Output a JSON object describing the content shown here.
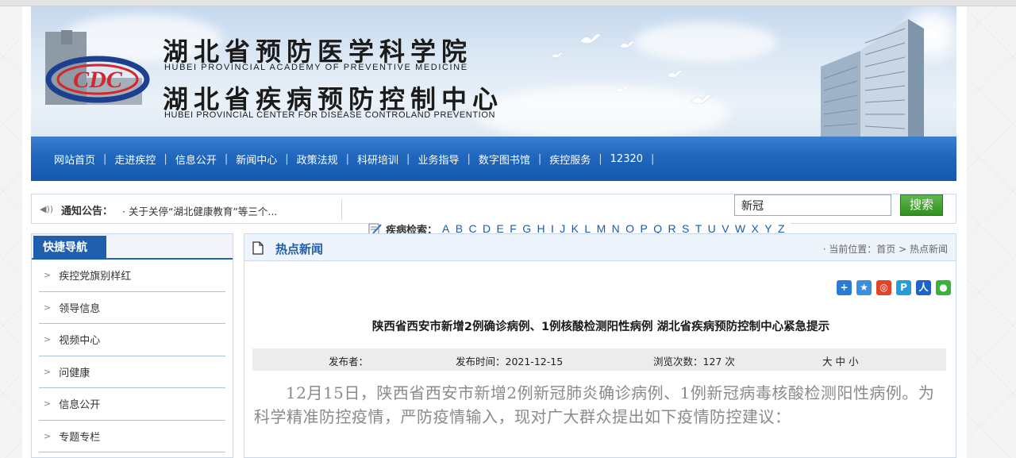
{
  "header": {
    "title_cn_1": "湖北省预防医学科学院",
    "title_en_1": "HUBEI PROVINCIAL ACADEMY OF PREVENTIVE MEDICINE",
    "title_cn_2": "湖北省疾病预防控制中心",
    "title_en_2": "HUBEI PROVINCIAL CENTER FOR DISEASE CONTROLAND PREVENTION",
    "logo_text": "CDC"
  },
  "nav": {
    "items": [
      {
        "label": "网站首页"
      },
      {
        "label": "走进疾控"
      },
      {
        "label": "信息公开"
      },
      {
        "label": "新闻中心"
      },
      {
        "label": "政策法规"
      },
      {
        "label": "科研培训"
      },
      {
        "label": "业务指导"
      },
      {
        "label": "数字图书馆"
      },
      {
        "label": "疾控服务"
      },
      {
        "label": "12320"
      }
    ],
    "separator": "|"
  },
  "notice": {
    "label": "通知公告：",
    "text": "· 关于关停“湖北健康教育”等三个..."
  },
  "search": {
    "value": "新冠",
    "button_label": "搜索"
  },
  "disease_search": {
    "label": "疾病检索：",
    "letters": [
      "A",
      "B",
      "C",
      "D",
      "E",
      "F",
      "G",
      "H",
      "I",
      "J",
      "K",
      "L",
      "M",
      "N",
      "O",
      "P",
      "Q",
      "R",
      "S",
      "T",
      "U",
      "V",
      "W",
      "X",
      "Y",
      "Z"
    ]
  },
  "sidebar": {
    "title": "快捷导航",
    "items": [
      {
        "label": "疾控党旗别样红"
      },
      {
        "label": "领导信息"
      },
      {
        "label": "视频中心"
      },
      {
        "label": "问健康"
      },
      {
        "label": "信息公开"
      },
      {
        "label": "专题专栏"
      }
    ]
  },
  "main": {
    "title": "热点新闻",
    "breadcrumb": "· 当前位置：首页 > 热点新闻",
    "article_title": "陕西省西安市新增2例确诊病例、1例核酸检测阳性病例 湖北省疾病预防控制中心紧急提示",
    "meta": {
      "publisher": "发布者：",
      "publish_time": "发布时间：2021-12-15",
      "views": "浏览次数：127 次",
      "font_size": "大 中 小"
    },
    "body": "12月15日，陕西省西安市新增2例新冠肺炎确诊病例、1例新冠病毒核酸检测阳性病例。为科学精准防控疫情，严防疫情输入，现对广大群众提出如下疫情防控建议："
  },
  "colors": {
    "nav_blue": "#1f66bd",
    "search_green": "#3a9a2a",
    "accent_blue": "#1f5fae"
  }
}
